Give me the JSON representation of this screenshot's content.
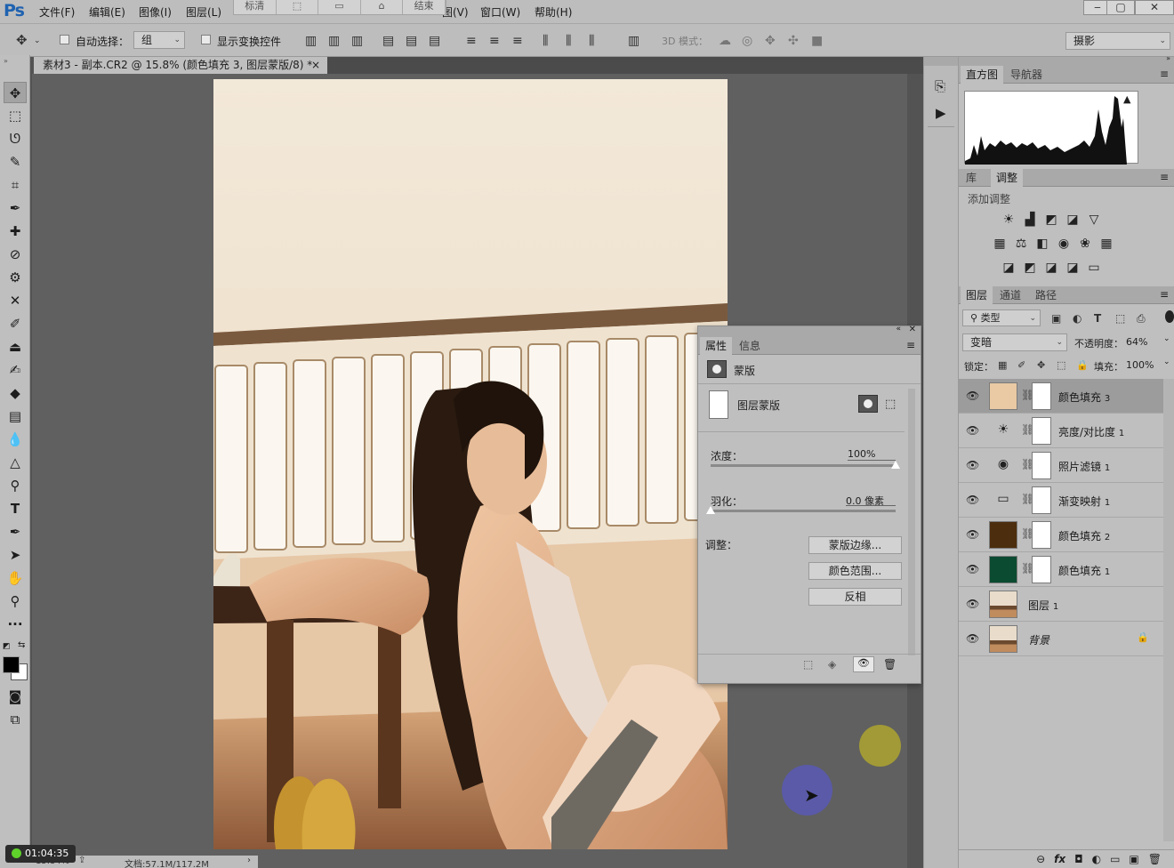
{
  "app": {
    "logo": "Ps"
  },
  "menubar": {
    "items": [
      "文件(F)",
      "编辑(E)",
      "图像(I)",
      "图层(L)",
      "图(V)",
      "窗口(W)",
      "帮助(H)"
    ],
    "floating_toolbar": [
      "标清",
      "",
      "",
      "",
      "结束"
    ],
    "window_buttons": [
      "‒",
      "▢",
      "✕"
    ]
  },
  "options_bar": {
    "auto_select_label": "自动选择：",
    "auto_select_value": "组",
    "show_transform_label": "显示变换控件",
    "mode_3d_label": "3D 模式：",
    "workspace": "摄影"
  },
  "document": {
    "tab_title": "素材3 - 副本.CR2 @ 15.8% (颜色填充 3, 图层蒙版/8) *",
    "close": "×"
  },
  "status": {
    "zoom": "15.84%",
    "doc_size": "文档:57.1M/117.2M",
    "timer": "01:04:35"
  },
  "histogram_panel": {
    "tabs": [
      "直方图",
      "导航器"
    ],
    "warning": "▲"
  },
  "adjust_panel": {
    "tabs": [
      "库",
      "调整"
    ],
    "add_label": "添加调整",
    "row1": [
      "☀",
      "▟",
      "◩",
      "◪",
      "▽"
    ],
    "row2": [
      "▦",
      "⚖",
      "◧",
      "◉",
      "❀",
      "▦"
    ],
    "row3": [
      "◪",
      "◩",
      "◪",
      "◪",
      "▭"
    ]
  },
  "layers_panel": {
    "tabs": [
      "图层",
      "通道",
      "路径"
    ],
    "filter_type": "类型",
    "blend_mode": "变暗",
    "opacity_label": "不透明度：",
    "opacity_value": "64%",
    "lock_label": "锁定：",
    "fill_label": "填充：",
    "fill_value": "100%",
    "layers": [
      {
        "name": "颜色填充",
        "num": "3",
        "kind": "fill",
        "color": "#e9caa4",
        "selected": true
      },
      {
        "name": "亮度/对比度",
        "num": "1",
        "kind": "adj",
        "icon": "☀"
      },
      {
        "name": "照片滤镜",
        "num": "1",
        "kind": "adj",
        "icon": "◉"
      },
      {
        "name": "渐变映射",
        "num": "1",
        "kind": "adj",
        "icon": "▭"
      },
      {
        "name": "颜色填充",
        "num": "2",
        "kind": "fill",
        "color": "#4c2d0d"
      },
      {
        "name": "颜色填充",
        "num": "1",
        "kind": "fill",
        "color": "#0b4b31"
      },
      {
        "name": "图层",
        "num": "1",
        "kind": "photo"
      },
      {
        "name": "背景",
        "num": "",
        "kind": "photo",
        "locked": true
      }
    ],
    "bottom_icons": [
      "⊖",
      "fx",
      "◘",
      "◐",
      "▭",
      "▣",
      "🗑"
    ]
  },
  "properties_panel": {
    "tabs": [
      "属性",
      "信息"
    ],
    "header": "蒙版",
    "mask_type": "图层蒙版",
    "density_label": "浓度：",
    "density_value": "100%",
    "density": 1.0,
    "feather_label": "羽化：",
    "feather_value": "0.0 像素",
    "feather": 0.0,
    "adjust_label": "调整：",
    "btn_mask_edge": "蒙版边缘...",
    "btn_color_range": "颜色范围...",
    "btn_invert": "反相"
  },
  "colors": {
    "ui_bg": "#bfbfbf",
    "canvas_bg": "#606060",
    "accent_blue": "#1f62b0",
    "cursor_circle": "#5a5aa8",
    "indicator_circle": "#a29a36"
  }
}
